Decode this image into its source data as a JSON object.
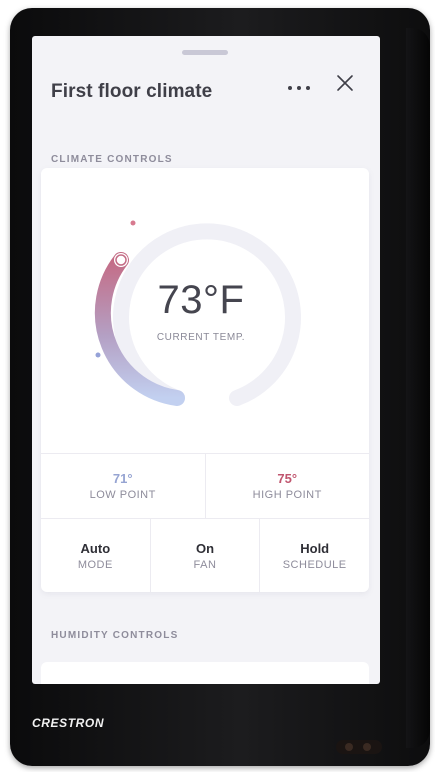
{
  "header": {
    "title": "First floor climate"
  },
  "sections": {
    "climate": "CLIMATE CONTROLS",
    "humidity": "HUMIDITY CONTROLS"
  },
  "thermostat": {
    "current_temp": "73°F",
    "current_label": "CURRENT TEMP.",
    "low_point": {
      "value": "71°",
      "label": "LOW POINT"
    },
    "high_point": {
      "value": "75°",
      "label": "HIGH POINT"
    }
  },
  "controls": [
    {
      "value": "Auto",
      "label": "MODE"
    },
    {
      "value": "On",
      "label": "FAN"
    },
    {
      "value": "Hold",
      "label": "SCHEDULE"
    }
  ],
  "brand": "CRESTRON",
  "colors": {
    "cool": "#a9b8e6",
    "heat": "#c75f78",
    "track": "#f0f0f6"
  },
  "icons": {
    "more": "more-horizontal-icon",
    "close": "close-icon"
  }
}
